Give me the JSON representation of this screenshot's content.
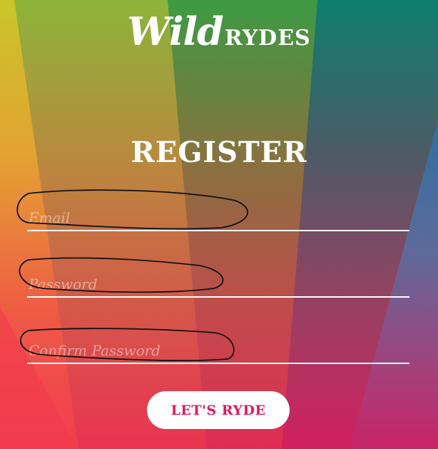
{
  "brand": {
    "wild": "Wild",
    "rydes": "RYDES"
  },
  "form": {
    "title": "REGISTER",
    "email_placeholder": "Email",
    "password_placeholder": "Password",
    "confirm_placeholder": "Confirm Password",
    "submit_label": "LET'S RYDE"
  },
  "colors": {
    "button_text": "#e2185c",
    "text": "#ffffff"
  }
}
